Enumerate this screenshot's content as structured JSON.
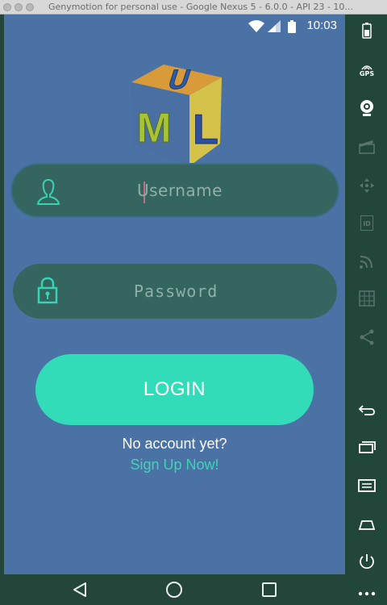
{
  "window": {
    "title": "Genymotion for personal use - Google Nexus 5 - 6.0.0 - API 23 - 10..."
  },
  "statusbar": {
    "time": "10:03",
    "icons": [
      "wifi-icon",
      "cell-signal-icon",
      "battery-icon"
    ]
  },
  "app": {
    "logo_letters": [
      "U",
      "M",
      "L"
    ],
    "username": {
      "value": "",
      "placeholder": "Username",
      "icon": "user-icon"
    },
    "password": {
      "value": "",
      "placeholder": "Password",
      "icon": "padlock-icon"
    },
    "login_label": "LOGIN",
    "no_account_text": "No account yet?",
    "signup_text": "Sign Up Now!",
    "colors": {
      "screen_bg": "#4a72a4",
      "field_bg": "#34655f",
      "accent": "#33dcb9",
      "link": "#3fd4b6"
    }
  },
  "navbar": {
    "buttons": [
      "back-icon",
      "home-icon",
      "recents-icon"
    ]
  },
  "sidebar": {
    "tools": [
      {
        "name": "battery-tool",
        "icon": "battery-icon"
      },
      {
        "name": "gps-tool",
        "icon": "gps-icon",
        "label": "GPS"
      },
      {
        "name": "webcam-tool",
        "icon": "webcam-icon"
      },
      {
        "name": "capture-tool",
        "icon": "clapperboard-icon"
      },
      {
        "name": "remote-control-tool",
        "icon": "dpad-icon"
      },
      {
        "name": "identifiers-tool",
        "icon": "id-icon",
        "label": "ID"
      },
      {
        "name": "network-tool",
        "icon": "signal-waves-icon"
      },
      {
        "name": "phone-tool",
        "icon": "grid-icon"
      },
      {
        "name": "share-tool",
        "icon": "share-icon"
      },
      {
        "name": "back-tool",
        "icon": "back-arrow-icon"
      },
      {
        "name": "recent-apps-tool",
        "icon": "recent-apps-icon"
      },
      {
        "name": "menu-tool",
        "icon": "menu-icon"
      },
      {
        "name": "home-tool",
        "icon": "home-icon"
      },
      {
        "name": "power-tool",
        "icon": "power-icon"
      },
      {
        "name": "more-tool",
        "icon": "more-icon"
      }
    ]
  }
}
